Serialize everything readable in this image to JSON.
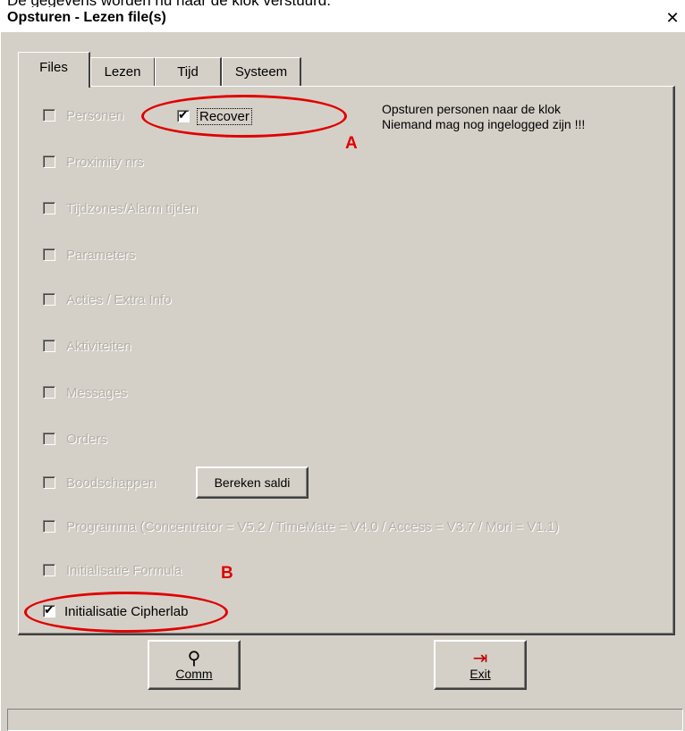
{
  "doc_header": "De gegevens worden nu naar de klok verstuurd.",
  "window": {
    "title": "Opsturen - Lezen file(s)",
    "close_glyph": "✕"
  },
  "tabs": [
    {
      "label": "Files",
      "active": true
    },
    {
      "label": "Lezen",
      "active": false
    },
    {
      "label": "Tijd",
      "active": false
    },
    {
      "label": "Systeem",
      "active": false
    }
  ],
  "checkboxes": [
    {
      "label": "Personen",
      "checked": false,
      "enabled": false
    },
    {
      "label": "Proximity nrs",
      "checked": false,
      "enabled": false
    },
    {
      "label": "Tijdzones/Alarm tijden",
      "checked": false,
      "enabled": false
    },
    {
      "label": "Parameters",
      "checked": false,
      "enabled": false
    },
    {
      "label": "Acties / Extra Info",
      "checked": false,
      "enabled": false
    },
    {
      "label": "Aktiviteiten",
      "checked": false,
      "enabled": false
    },
    {
      "label": "Messages",
      "checked": false,
      "enabled": false
    },
    {
      "label": "Orders",
      "checked": false,
      "enabled": false
    },
    {
      "label": "Boodschappen",
      "checked": false,
      "enabled": false
    },
    {
      "label": "Programma (Concentrator = V5.2 / TimeMate = V4.0 / Access = V3.7 / Mori = V1.1)",
      "checked": false,
      "enabled": false
    },
    {
      "label": "Initialisatie Formula",
      "checked": false,
      "enabled": false
    },
    {
      "label": "Initialisatie Cipherlab",
      "checked": true,
      "enabled": true
    }
  ],
  "recover": {
    "label": "Recover",
    "checked": true
  },
  "info": {
    "line1": "Opsturen personen naar de klok",
    "line2": "Niemand mag nog ingelogged zijn !!!"
  },
  "buttons": {
    "bereken_saldi": "Bereken saldi",
    "comm": "Comm",
    "exit": "Exit"
  },
  "annotations": {
    "a": "A",
    "b": "B"
  },
  "colors": {
    "annotation": "#e00000",
    "dialog_bg": "#d4d0c8"
  }
}
